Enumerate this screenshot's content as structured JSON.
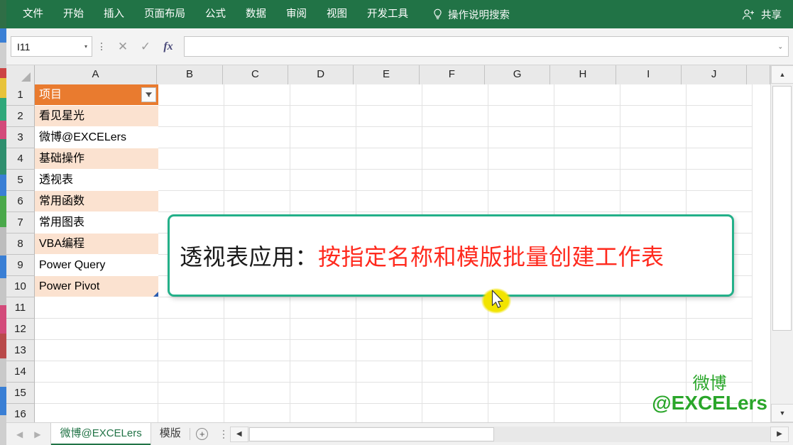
{
  "app": {
    "accent_green": "#217346",
    "table_header_orange": "#E97B2F",
    "table_band": "#FBE2D0",
    "textbox_border": "#23b089",
    "red_text": "#ff2a1e",
    "watermark_green": "#2aa62a"
  },
  "ribbon": {
    "tabs": [
      {
        "label": "文件"
      },
      {
        "label": "开始"
      },
      {
        "label": "插入"
      },
      {
        "label": "页面布局"
      },
      {
        "label": "公式"
      },
      {
        "label": "数据"
      },
      {
        "label": "审阅"
      },
      {
        "label": "视图"
      },
      {
        "label": "开发工具"
      }
    ],
    "tell_me": {
      "icon": "lightbulb-icon",
      "label": "操作说明搜索"
    },
    "share": {
      "icon": "person-share-icon",
      "label": "共享"
    }
  },
  "formula_bar": {
    "name_box_value": "I11",
    "name_box_arrow": "▾",
    "cancel_label": "✕",
    "enter_label": "✓",
    "fx_label": "fx",
    "formula_value": "",
    "expand_label": "⌄"
  },
  "grid": {
    "columns": [
      "A",
      "B",
      "C",
      "D",
      "E",
      "F",
      "G",
      "H",
      "I",
      "J"
    ],
    "rows": [
      "1",
      "2",
      "3",
      "4",
      "5",
      "6",
      "7",
      "8",
      "9",
      "10",
      "11",
      "12",
      "13",
      "14",
      "15",
      "16"
    ],
    "column_a_values": [
      "项目",
      "看见星光",
      "微博@EXCELers",
      "基础操作",
      "透视表",
      "常用函数",
      "常用图表",
      "VBA编程",
      "Power Query",
      "Power Pivot",
      "",
      "",
      "",
      "",
      "",
      ""
    ],
    "filter_button_glyph": "▼",
    "select_all_icon": "select-all-corner-icon"
  },
  "textbox": {
    "text_black": "透视表应用：",
    "text_red": "按指定名称和模版批量创建工作表"
  },
  "watermark": {
    "line1": "微博",
    "line2": "@EXCELers"
  },
  "status_bar": {
    "prev_sheet_label": "◀",
    "next_sheet_label": "▶",
    "sheet_tabs": [
      {
        "label": "微博@EXCELers",
        "active": true
      },
      {
        "label": "模版",
        "active": false
      }
    ],
    "add_sheet_label": "+",
    "hscroll_left_label": "◀",
    "hscroll_right_label": "▶"
  },
  "scrollbars": {
    "v_up_label": "▲",
    "v_down_label": "▼"
  }
}
